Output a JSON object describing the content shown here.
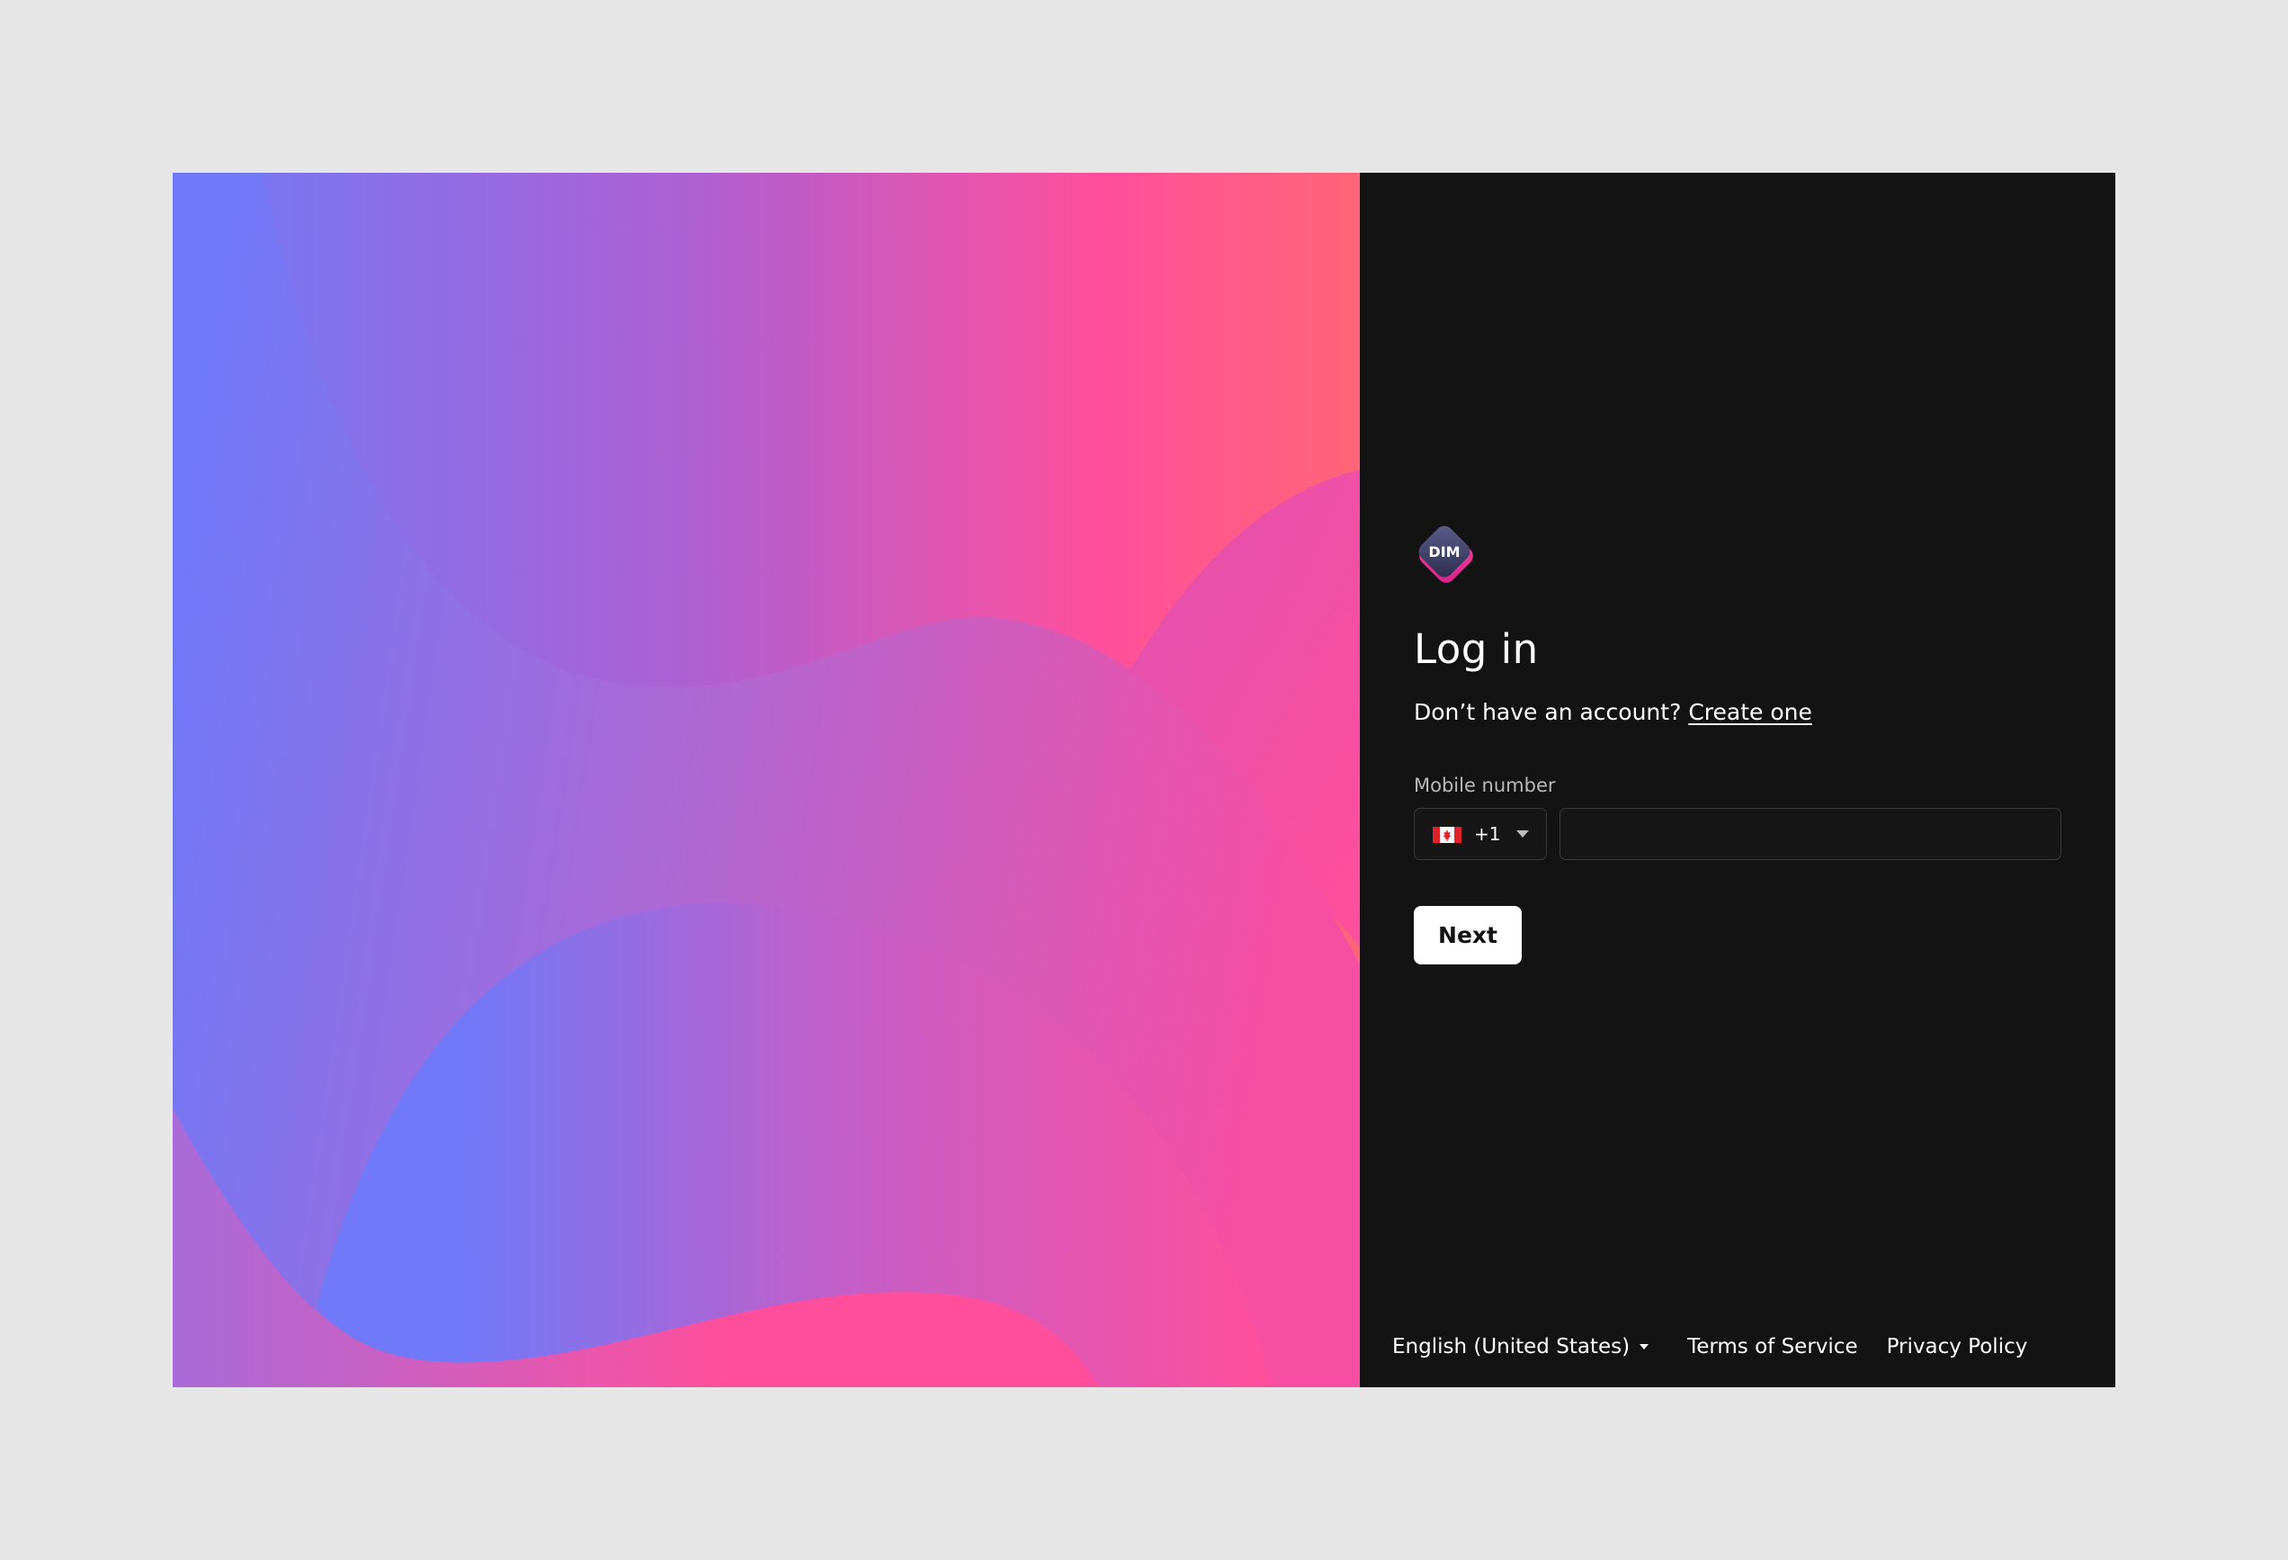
{
  "brand": {
    "logo_text": "DIM",
    "logo_icon": "dim-diamond-logo"
  },
  "login": {
    "title": "Log in",
    "no_account_text": "Don’t have an account?",
    "create_link": "Create one",
    "mobile_label": "Mobile number",
    "country": {
      "flag_icon": "canada-flag-icon",
      "dial_code": "+1"
    },
    "phone_value": "",
    "next_button": "Next"
  },
  "footer": {
    "language": "English (United States)",
    "terms": "Terms of Service",
    "privacy": "Privacy Policy"
  },
  "colors": {
    "panel_bg": "#131313",
    "page_bg": "#e6e6e6",
    "gradient_blue": "#7079f8",
    "gradient_pink": "#ff4f9c",
    "gradient_coral": "#ff6577"
  }
}
